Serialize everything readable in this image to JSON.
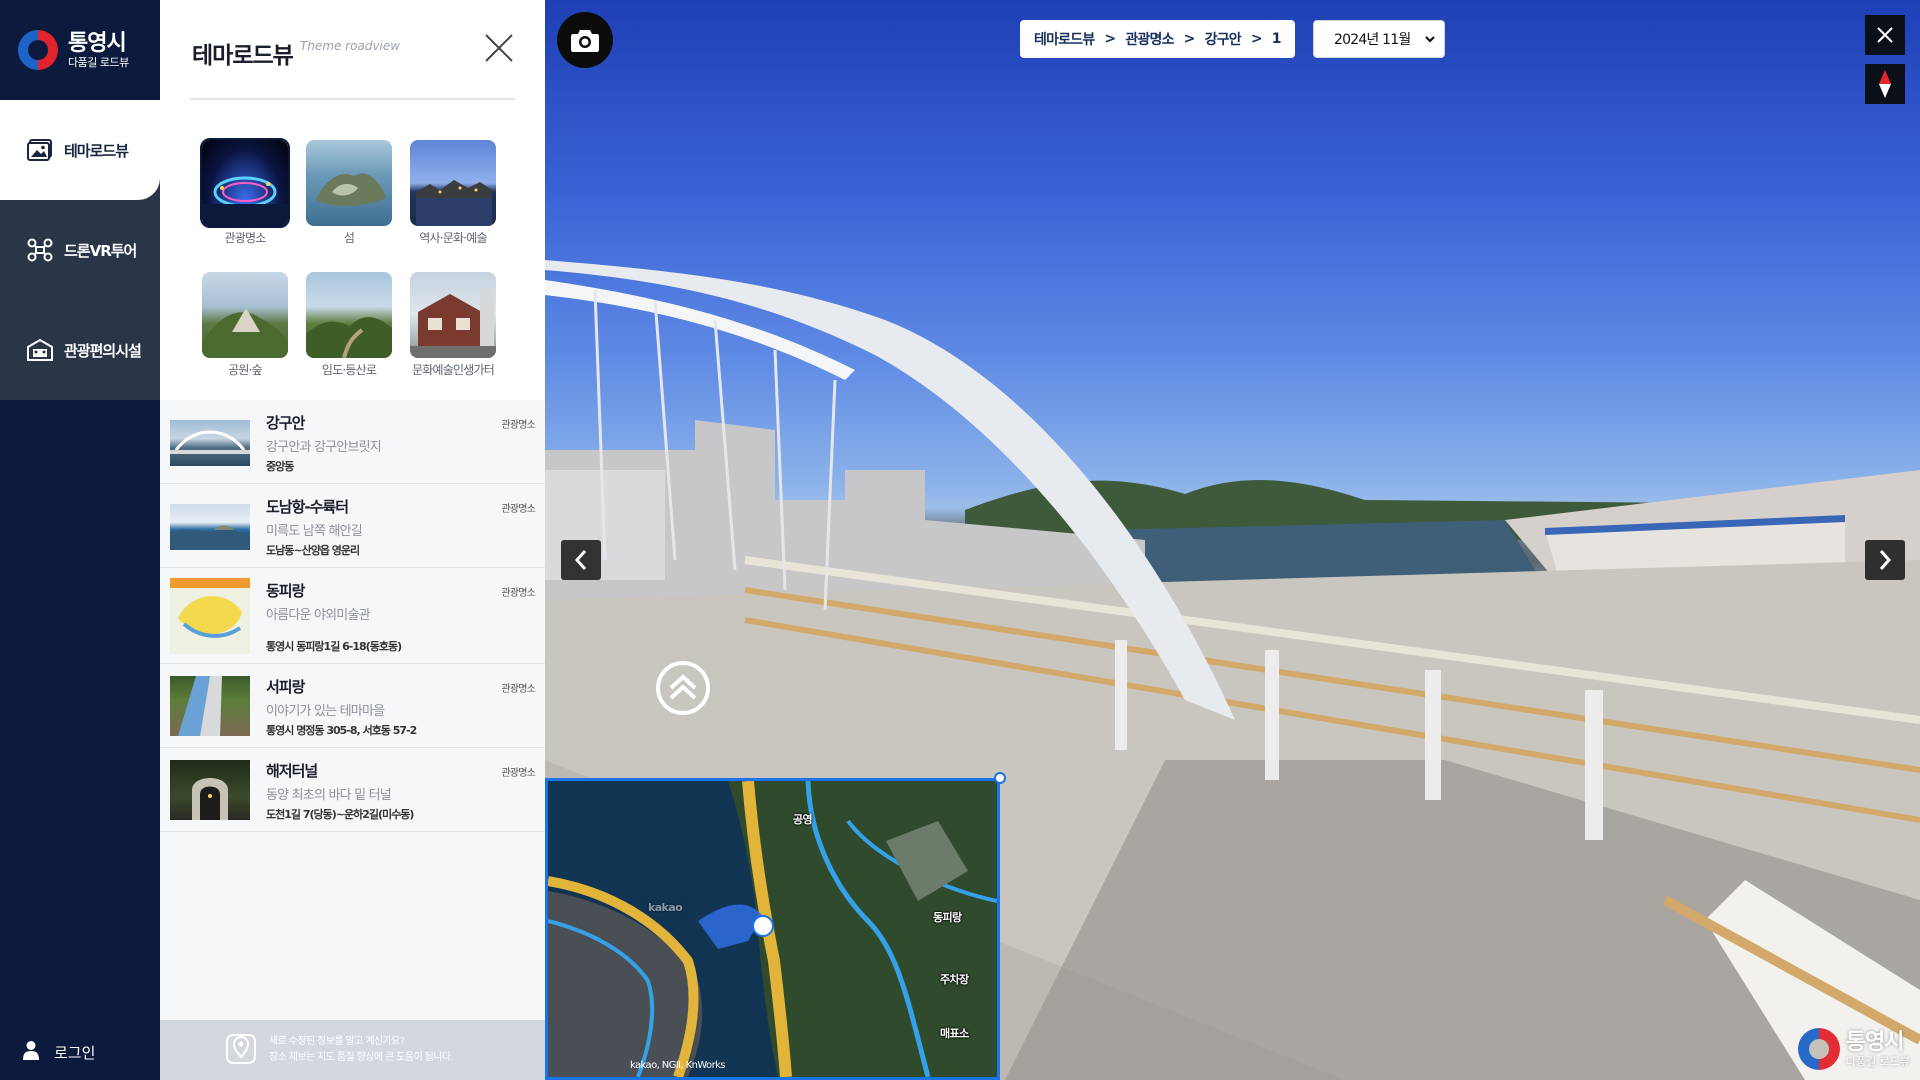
{
  "logo": {
    "name": "통영시",
    "sub": "다품길 로드뷰"
  },
  "nav": {
    "items": [
      {
        "label": "테마로드뷰",
        "icon": "image-icon",
        "active": true
      },
      {
        "label": "드론VR투어",
        "icon": "drone-icon",
        "active": false
      },
      {
        "label": "관광편의시설",
        "icon": "facility-icon",
        "active": false
      }
    ],
    "login": "로그인"
  },
  "panel": {
    "title": "테마로드뷰",
    "subtitle": "Theme roadview",
    "themes": [
      {
        "label": "관광명소",
        "selected": true
      },
      {
        "label": "섬",
        "selected": false
      },
      {
        "label": "역사·문화·예술",
        "selected": false
      },
      {
        "label": "공원·숲",
        "selected": false
      },
      {
        "label": "임도·등산로",
        "selected": false
      },
      {
        "label": "문화예술인생가터",
        "selected": false
      }
    ],
    "places": [
      {
        "title": "강구안",
        "desc": "강구안과 강구안브릿지",
        "addr": "중앙동",
        "category": "관광명소"
      },
      {
        "title": "도남항-수륙터",
        "desc": "미륵도 남쪽 해안길",
        "addr": "도남동~산양읍 영운리",
        "category": "관광명소"
      },
      {
        "title": "동피랑",
        "desc": "아름다운 야외미술관",
        "addr": "통영시 동피랑1길 6-18(동호동)",
        "category": "관광명소"
      },
      {
        "title": "서피랑",
        "desc": "이야기가 있는 테마마을",
        "addr": "통영시 명정동 305-8, 서호동 57-2",
        "category": "관광명소"
      },
      {
        "title": "해저터널",
        "desc": "동양 최초의 바다 밑 터널",
        "addr": "도천1길 7(당동)~운하2길(미수동)",
        "category": "관광명소"
      }
    ],
    "footer": {
      "line1": "새로 수정된 정보를 알고 계신가요?",
      "line2": "장소 제보는 지도 품질 향상에 큰 도움이 됩니다."
    }
  },
  "viewer": {
    "breadcrumb": [
      "테마로드뷰",
      "관광명소",
      "강구안",
      "1"
    ],
    "breadcrumb_sep": ">",
    "date": "2024년 11월",
    "map": {
      "credit": "kakao, NGII, KnWorks",
      "labels": [
        "공영",
        "동피랑",
        "주차장",
        "매표소",
        "kakao"
      ]
    },
    "watermark": {
      "name": "통영시",
      "sub": "다품길 로드뷰"
    }
  },
  "colors": {
    "rail": "#0c1b3d",
    "rail_menu": "#2a3547",
    "accent": "#1b73e8"
  }
}
